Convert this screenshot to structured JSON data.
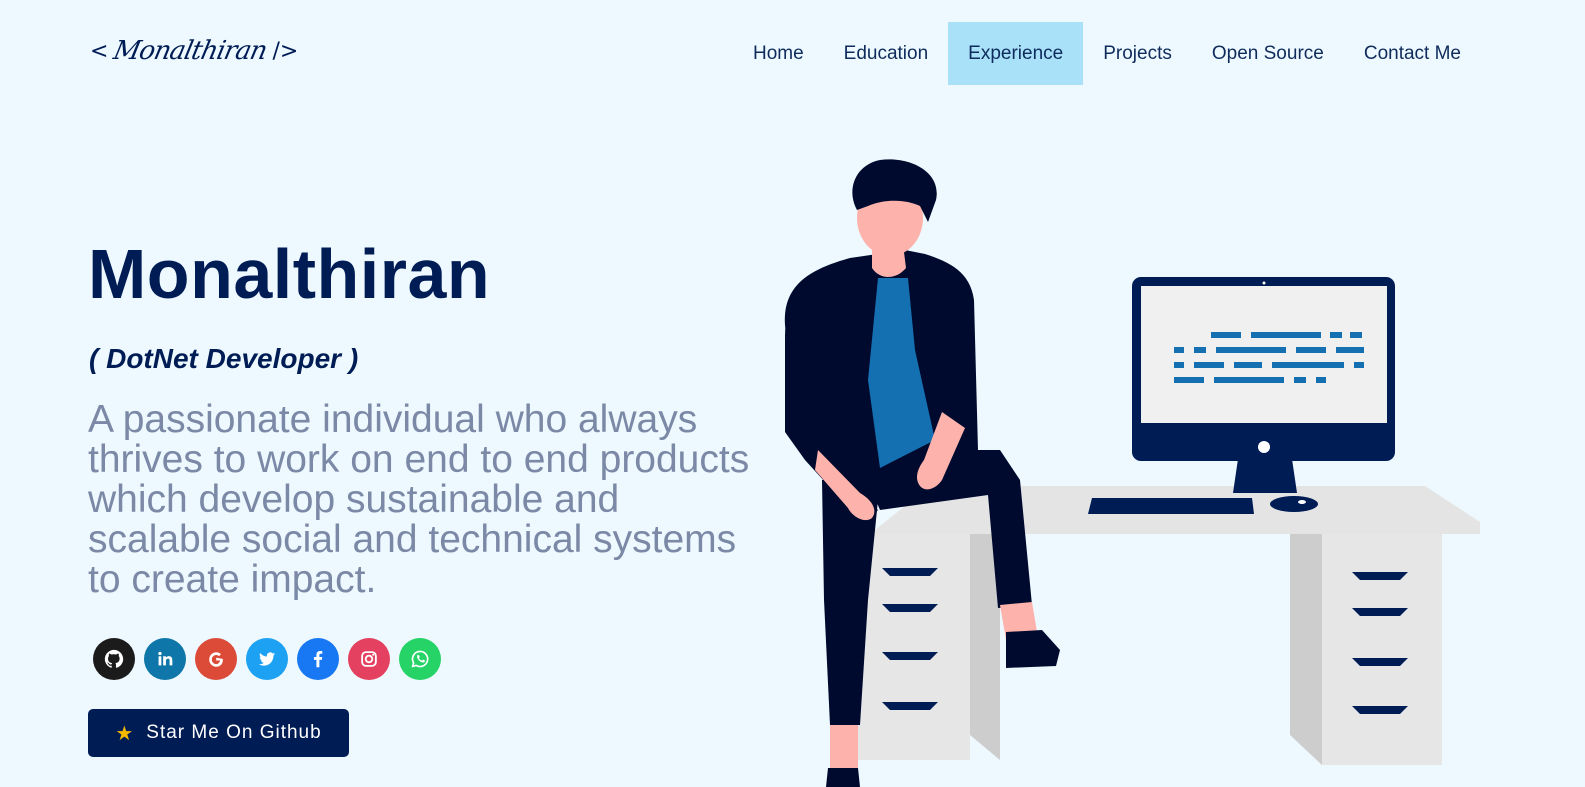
{
  "logo": {
    "open": "<",
    "signature": "Monalthiran",
    "close": "/>"
  },
  "nav": [
    {
      "label": "Home",
      "active": false
    },
    {
      "label": "Education",
      "active": false
    },
    {
      "label": "Experience",
      "active": true
    },
    {
      "label": "Projects",
      "active": false
    },
    {
      "label": "Open Source",
      "active": false
    },
    {
      "label": "Contact Me",
      "active": false
    }
  ],
  "hero": {
    "name": "Monalthiran",
    "role": "( DotNet Developer )",
    "description": "A passionate individual who always thrives to work on end to end products which develop sustainable and scalable social and technical systems to create impact."
  },
  "socials": [
    {
      "name": "github-icon",
      "color": "#1b1b1b"
    },
    {
      "name": "linkedin-icon",
      "color": "#0e76a8"
    },
    {
      "name": "google-icon",
      "color": "#dc4a38"
    },
    {
      "name": "twitter-icon",
      "color": "#1da1f2"
    },
    {
      "name": "facebook-icon",
      "color": "#1877f2"
    },
    {
      "name": "instagram-icon",
      "color": "#e4405f"
    },
    {
      "name": "whatsapp-icon",
      "color": "#25d366"
    }
  ],
  "cta": {
    "label": "Star Me On Github",
    "icon": "star-icon"
  },
  "colors": {
    "background": "#edf9fe",
    "primary": "#001c55",
    "nav_active": "#a8e1f8",
    "muted": "#7b88a6",
    "accent_blue": "#1470b0"
  }
}
